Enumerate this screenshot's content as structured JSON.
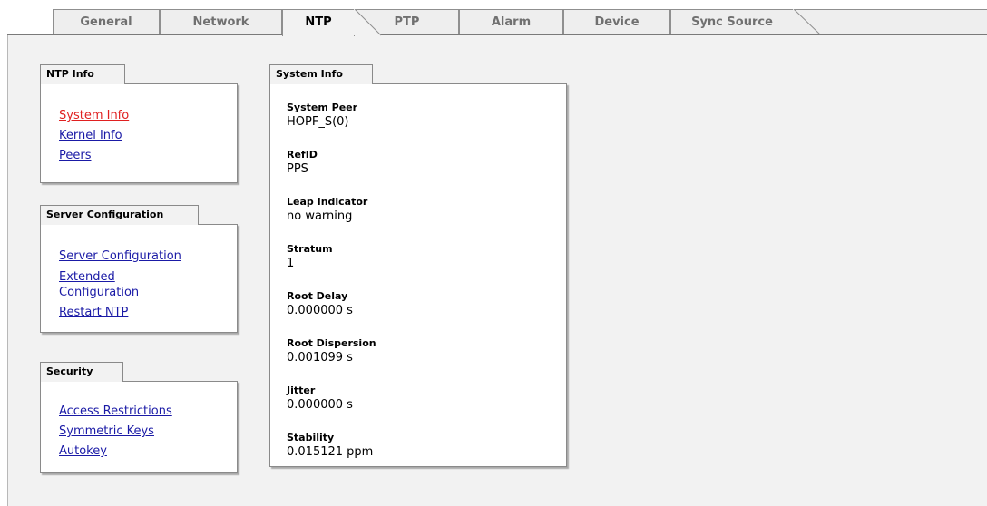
{
  "tabs": [
    {
      "label": "General",
      "active": false
    },
    {
      "label": "Network",
      "active": false
    },
    {
      "label": "NTP",
      "active": true
    },
    {
      "label": "PTP",
      "active": false
    },
    {
      "label": "Alarm",
      "active": false
    },
    {
      "label": "Device",
      "active": false
    },
    {
      "label": "Sync Source",
      "active": false
    }
  ],
  "sidebar": {
    "ntp_info": {
      "title": "NTP Info",
      "links": [
        "System Info",
        "Kernel Info",
        "Peers"
      ],
      "current": "System Info"
    },
    "server_config": {
      "title": "Server Configuration",
      "links": [
        "Server Configuration",
        "Extended Configuration",
        "Restart NTP"
      ]
    },
    "security": {
      "title": "Security",
      "links": [
        "Access Restrictions",
        "Symmetric Keys",
        "Autokey"
      ]
    }
  },
  "system_info": {
    "title": "System Info",
    "items": [
      {
        "label": "System Peer",
        "value": "HOPF_S(0)"
      },
      {
        "label": "RefID",
        "value": "PPS"
      },
      {
        "label": "Leap Indicator",
        "value": "no warning"
      },
      {
        "label": "Stratum",
        "value": "1"
      },
      {
        "label": "Root Delay",
        "value": "0.000000 s"
      },
      {
        "label": "Root Dispersion",
        "value": "0.001099 s"
      },
      {
        "label": "Jitter",
        "value": "0.000000 s"
      },
      {
        "label": "Stability",
        "value": "0.015121 ppm"
      }
    ]
  },
  "colors": {
    "link": "#1a1aa6",
    "current_link": "#e02020",
    "content_bg": "#f2f2f2",
    "tab_inactive_text": "#707070"
  }
}
